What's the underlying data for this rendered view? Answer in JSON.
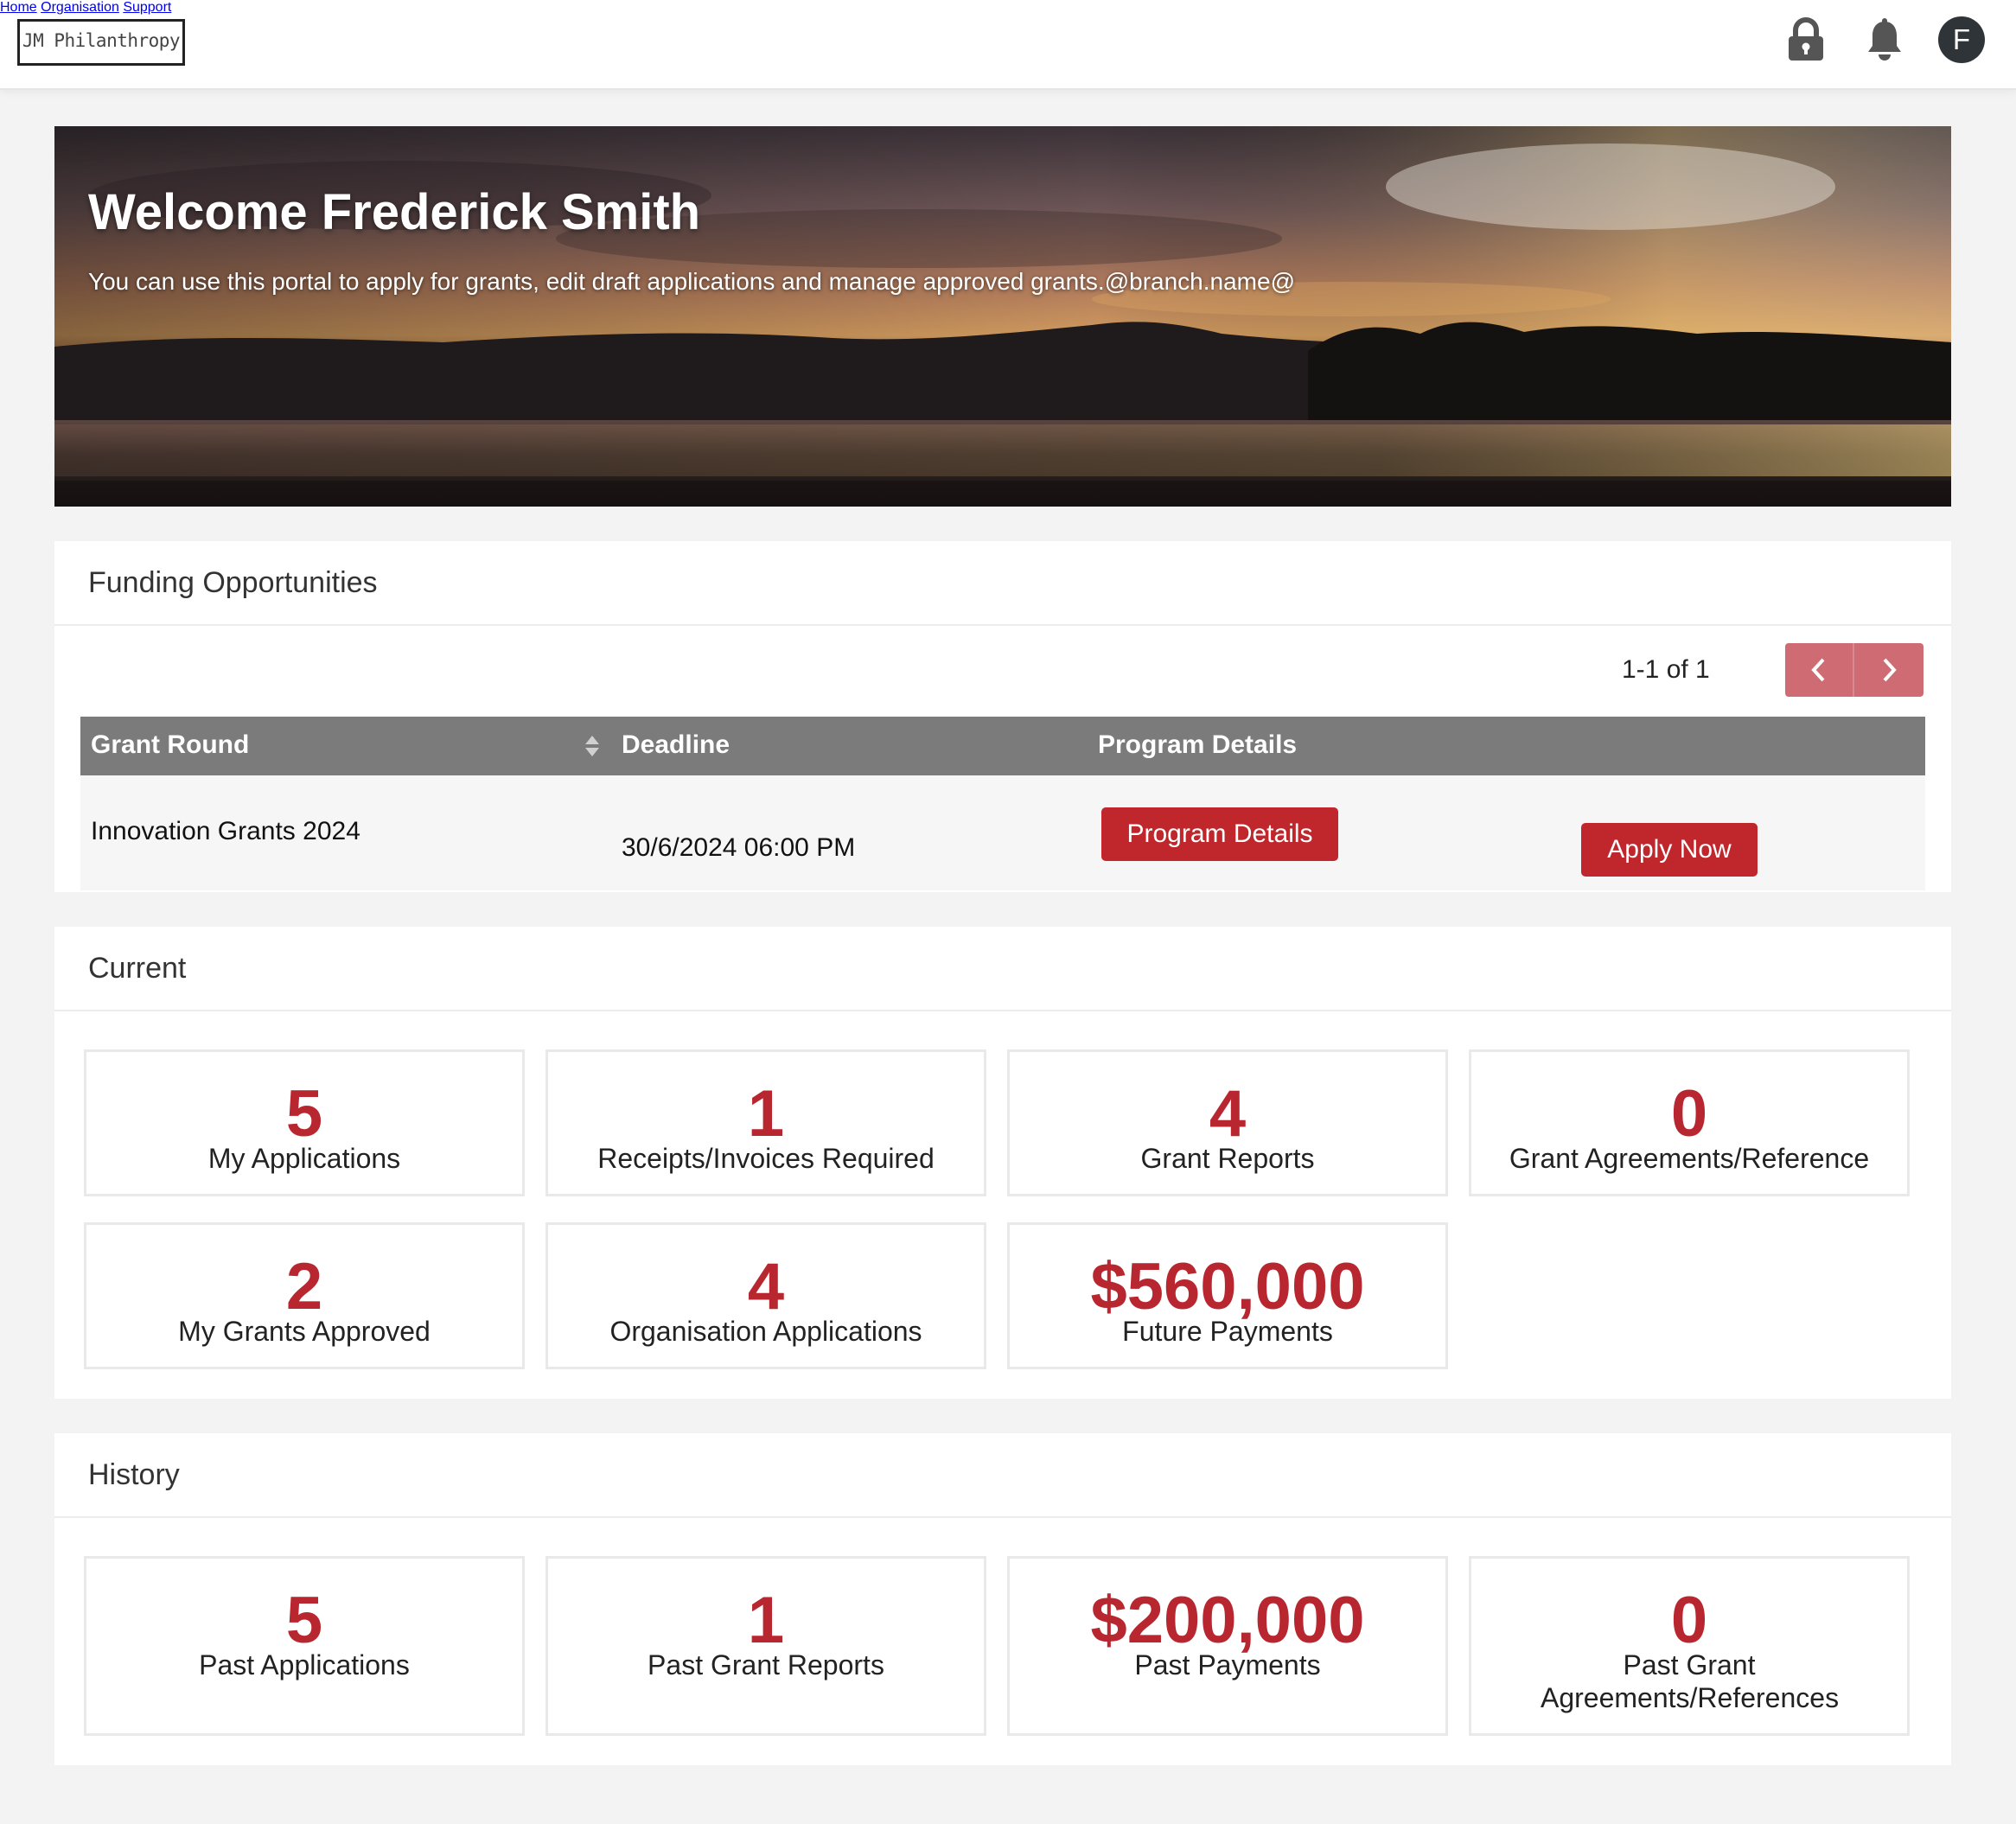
{
  "header": {
    "logo_text": "JM Philanthropy",
    "nav": [
      "Home",
      "Organisation",
      "Support"
    ],
    "avatar_initial": "F",
    "icons": [
      "lock-icon",
      "bell-icon"
    ]
  },
  "hero": {
    "title": "Welcome Frederick Smith",
    "subtitle": "You can use this portal to apply for grants, edit draft applications and manage approved grants.@branch.name@"
  },
  "funding": {
    "title": "Funding Opportunities",
    "pagination": "1-1 of 1",
    "columns": [
      "Grant Round",
      "Deadline",
      "Program Details"
    ],
    "rows": [
      {
        "grant_round": "Innovation Grants 2024",
        "deadline": "30/6/2024 06:00 PM",
        "details_button": "Program Details",
        "apply_button": "Apply Now"
      }
    ]
  },
  "current": {
    "title": "Current",
    "stats": [
      {
        "value": "5",
        "label": "My Applications"
      },
      {
        "value": "1",
        "label": "Receipts/Invoices Required"
      },
      {
        "value": "4",
        "label": "Grant Reports"
      },
      {
        "value": "0",
        "label": "Grant Agreements/Reference"
      },
      {
        "value": "2",
        "label": "My Grants Approved"
      },
      {
        "value": "4",
        "label": "Organisation Applications"
      },
      {
        "value": "$560,000",
        "label": "Future Payments"
      }
    ]
  },
  "history": {
    "title": "History",
    "stats": [
      {
        "value": "5",
        "label": "Past Applications"
      },
      {
        "value": "1",
        "label": "Past Grant Reports"
      },
      {
        "value": "$200,000",
        "label": "Past Payments"
      },
      {
        "value": "0",
        "label": "Past Grant Agreements/References"
      }
    ]
  },
  "colors": {
    "accent": "#c0272d",
    "stat_number": "#b8262f",
    "table_header": "#7b7b7b",
    "pager": "#cf6b73"
  }
}
